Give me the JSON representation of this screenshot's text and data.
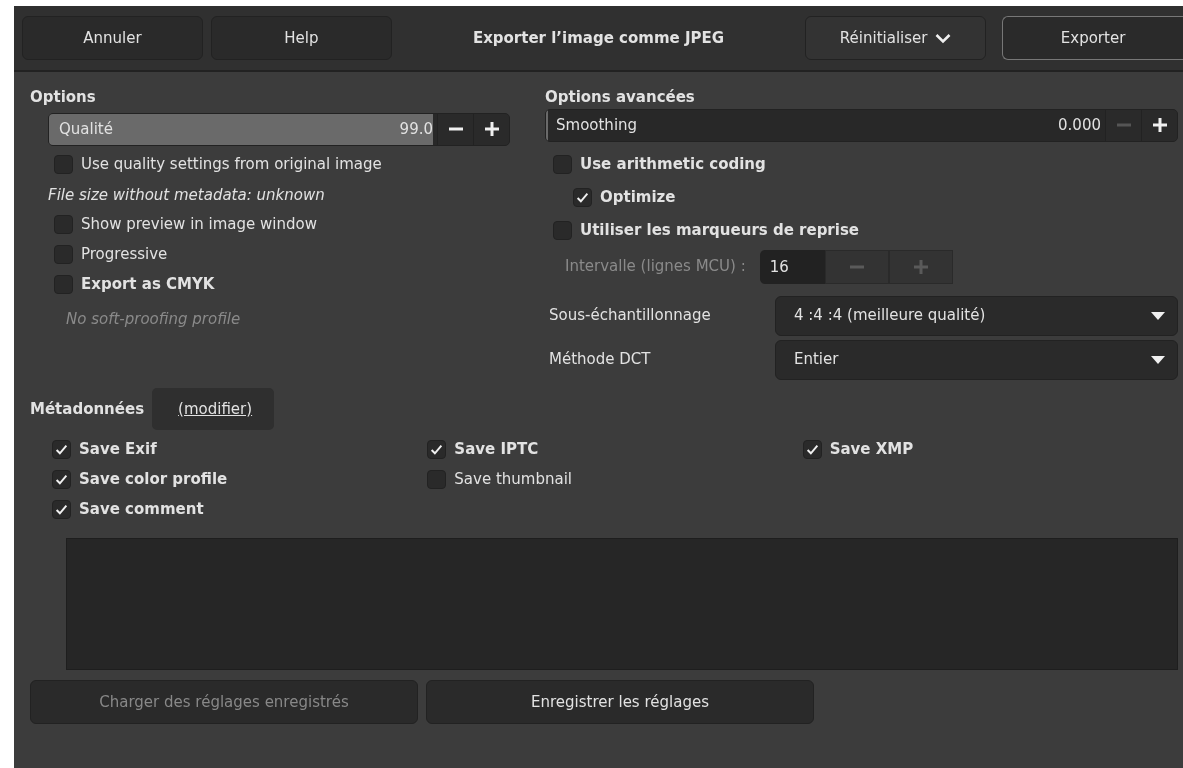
{
  "header": {
    "buttons": [
      {
        "label": "Annuler"
      },
      {
        "label": "Help"
      }
    ],
    "title": "Exporter l’image comme JPEG",
    "reset": {
      "label": "Réinitialiser"
    },
    "export": {
      "label": "Exporter"
    }
  },
  "options": {
    "heading": "Options",
    "quality": {
      "label": "Qualité",
      "value": "99.0",
      "level": 0.99,
      "minus_disabled": false
    },
    "items": [
      {
        "kind": "checkbox",
        "label": "Use quality settings from original image",
        "checked": false,
        "bold": false
      },
      {
        "kind": "note",
        "text": "File size without metadata: unknown",
        "muted": false
      },
      {
        "kind": "checkbox",
        "label": "Show preview in image window",
        "checked": false,
        "bold": false
      },
      {
        "kind": "checkbox",
        "label": "Progressive",
        "checked": false,
        "bold": false
      },
      {
        "kind": "checkbox",
        "label": "Export as CMYK",
        "checked": false,
        "bold": true
      },
      {
        "kind": "note",
        "text": "No soft-proofing profile",
        "muted": true
      }
    ]
  },
  "advanced": {
    "heading": "Options avancées",
    "smoothing": {
      "label": "Smoothing",
      "value": "0.000",
      "level": 0,
      "minus_disabled": true
    },
    "items": [
      {
        "label": "Use arithmetic coding",
        "checked": false,
        "bold": true,
        "children": [
          {
            "label": "Optimize",
            "checked": true,
            "bold": true
          }
        ]
      },
      {
        "label": "Utiliser les marqueurs de reprise",
        "checked": false,
        "bold": true
      }
    ],
    "interval": {
      "label": "Intervalle (lignes MCU) :",
      "value": "16",
      "disabled": true
    },
    "selects": [
      {
        "label": "Sous-échantillonnage",
        "value": "4 :4 :4 (meilleure qualité)"
      },
      {
        "label": "Méthode DCT",
        "value": "Entier"
      }
    ]
  },
  "metadata": {
    "heading": "Métadonnées",
    "link": "(modifier)",
    "columns": [
      [
        {
          "label": "Save Exif",
          "checked": true,
          "bold": true
        },
        {
          "label": "Save color profile",
          "checked": true,
          "bold": true
        },
        {
          "label": "Save comment",
          "checked": true,
          "bold": true
        }
      ],
      [
        {
          "label": "Save IPTC",
          "checked": true,
          "bold": true
        },
        {
          "label": "Save thumbnail",
          "checked": false,
          "bold": false
        }
      ],
      [
        {
          "label": "Save XMP",
          "checked": true,
          "bold": true
        }
      ]
    ]
  },
  "footer": [
    {
      "label": "Charger des réglages enregistrés",
      "disabled": true
    },
    {
      "label": "Enregistrer les réglages",
      "disabled": false
    }
  ]
}
